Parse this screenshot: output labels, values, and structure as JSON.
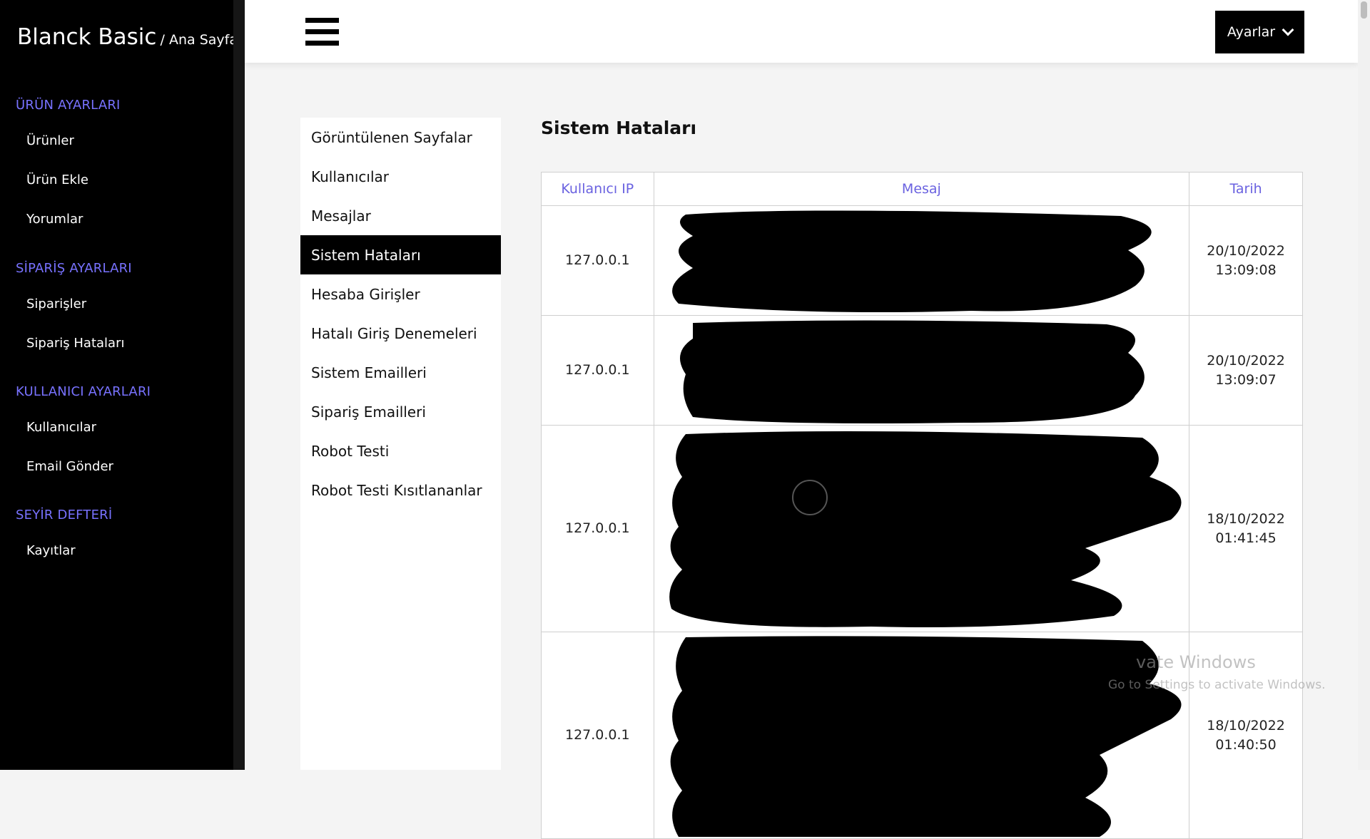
{
  "brand": {
    "name": "Blanck Basic",
    "breadcrumb": "/ Ana Sayfa"
  },
  "sidebar": {
    "sections": [
      {
        "title": "ÜRÜN AYARLARI",
        "items": [
          "Ürünler",
          "Ürün Ekle",
          "Yorumlar"
        ]
      },
      {
        "title": "SİPARİŞ AYARLARI",
        "items": [
          "Siparişler",
          "Sipariş Hataları"
        ]
      },
      {
        "title": "KULLANICI AYARLARI",
        "items": [
          "Kullanıcılar",
          "Email Gönder"
        ]
      },
      {
        "title": "SEYİR DEFTERİ",
        "items": [
          "Kayıtlar"
        ]
      }
    ]
  },
  "topbar": {
    "settings_label": "Ayarlar"
  },
  "menu": {
    "items": [
      "Görüntülenen Sayfalar",
      "Kullanıcılar",
      "Mesajlar",
      "Sistem Hataları",
      "Hesaba Girişler",
      "Hatalı Giriş Denemeleri",
      "Sistem Emailleri",
      "Sipariş Emailleri",
      "Robot Testi",
      "Robot Testi Kısıtlananlar"
    ],
    "active_index": 3
  },
  "content": {
    "title": "Sistem Hataları",
    "columns": [
      "Kullanıcı IP",
      "Mesaj",
      "Tarih"
    ],
    "rows": [
      {
        "ip": "127.0.0.1",
        "date": "20/10/2022",
        "time": "13:09:08"
      },
      {
        "ip": "127.0.0.1",
        "date": "20/10/2022",
        "time": "13:09:07"
      },
      {
        "ip": "127.0.0.1",
        "date": "18/10/2022",
        "time": "01:41:45"
      },
      {
        "ip": "127.0.0.1",
        "date": "18/10/2022",
        "time": "01:40:50"
      }
    ]
  },
  "watermark": {
    "line1": "vate Windows",
    "line2": "Go to Settings to activate Windows."
  },
  "colors": {
    "accent": "#7872ff",
    "header_text": "#6a62e0",
    "sidebar_bg": "#000000"
  }
}
